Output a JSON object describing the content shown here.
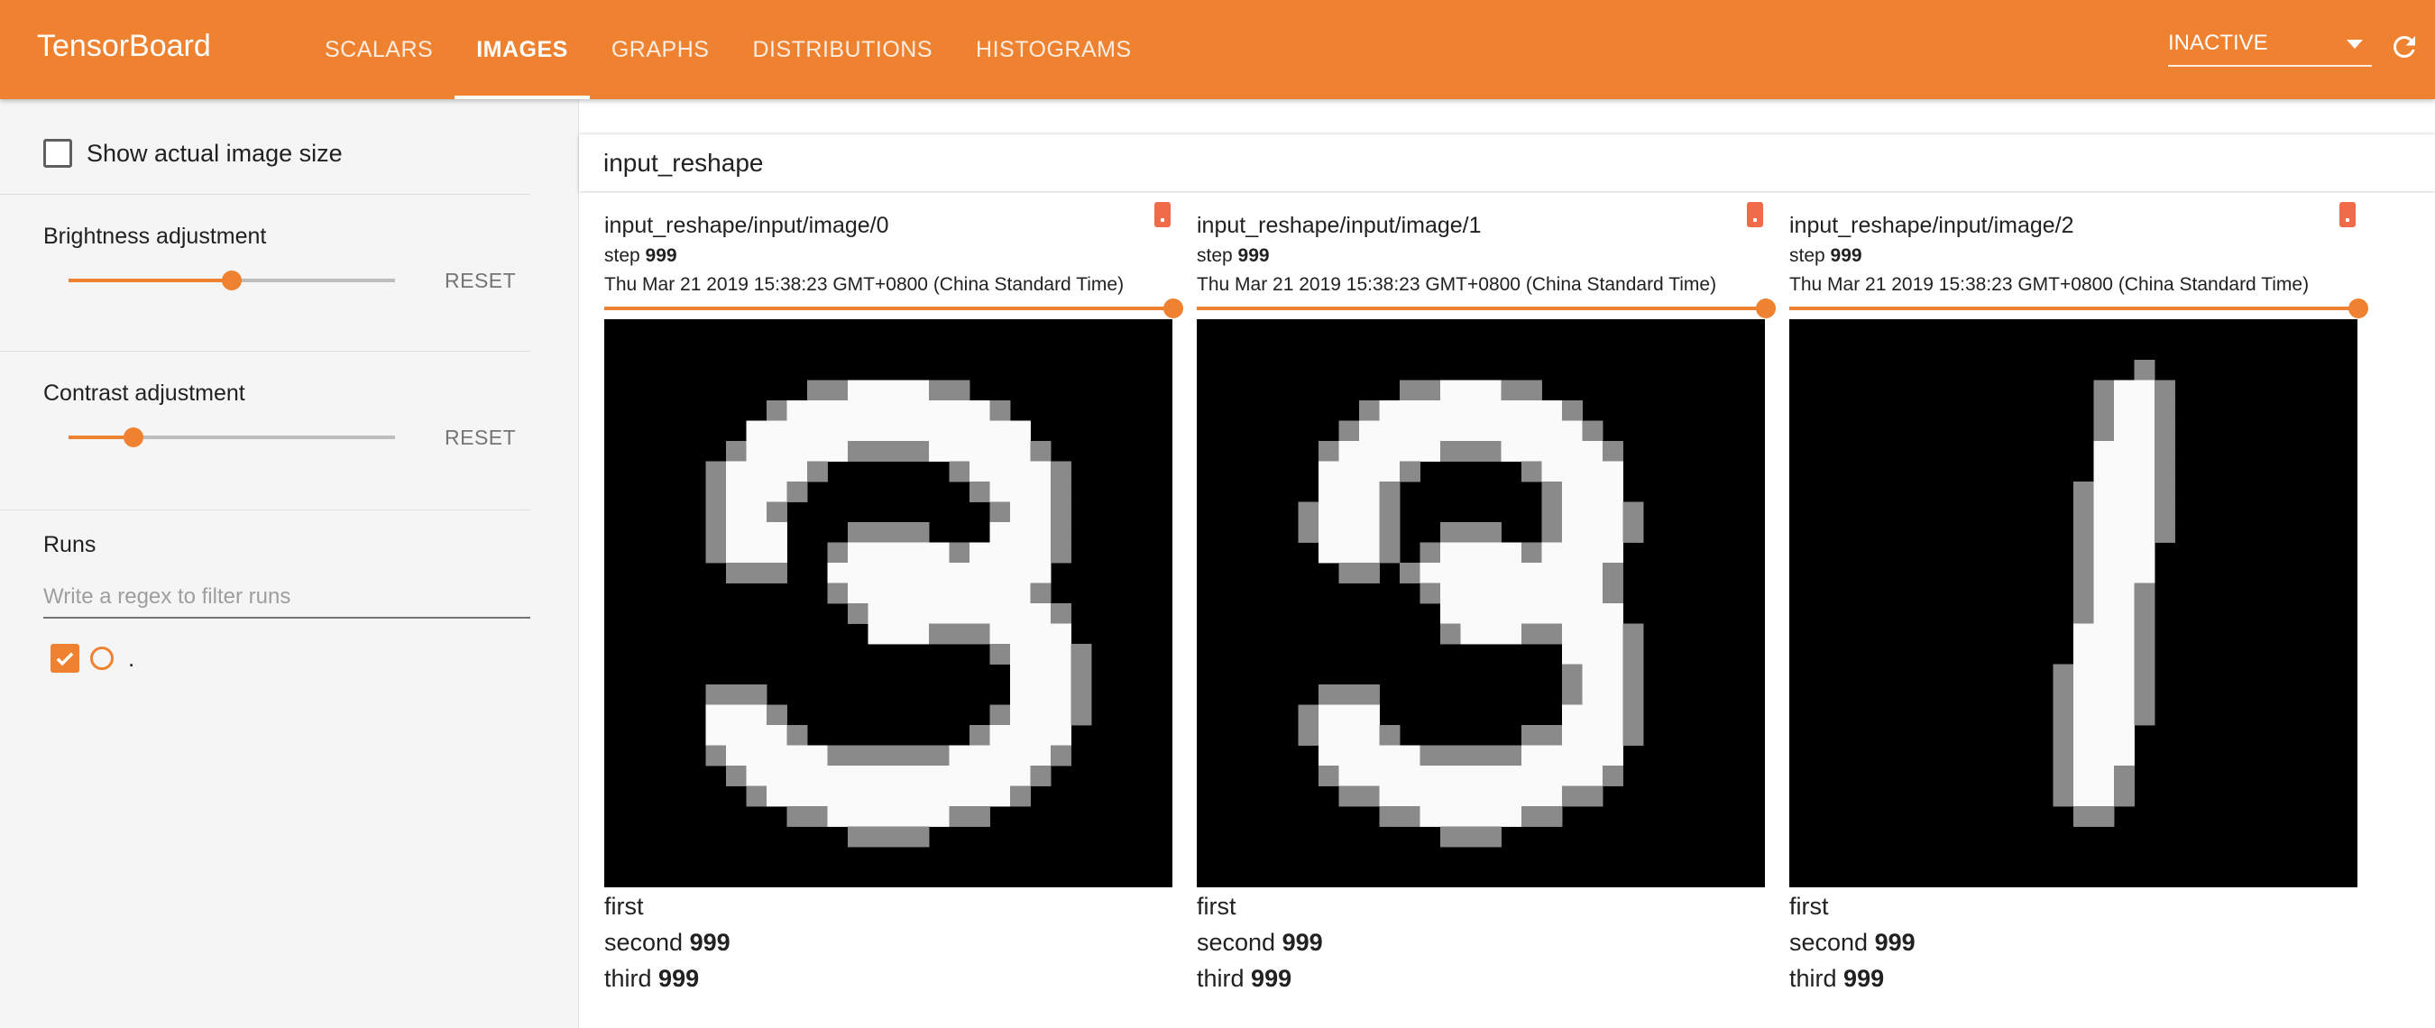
{
  "app": {
    "title": "TensorBoard"
  },
  "tabs": [
    {
      "label": "SCALARS",
      "active": false
    },
    {
      "label": "IMAGES",
      "active": true
    },
    {
      "label": "GRAPHS",
      "active": false
    },
    {
      "label": "DISTRIBUTIONS",
      "active": false
    },
    {
      "label": "HISTOGRAMS",
      "active": false
    }
  ],
  "status_select": {
    "value": "INACTIVE"
  },
  "colors": {
    "accent": "#ef8230",
    "menu_button": "#ef6b4a"
  },
  "sidebar": {
    "show_actual_size": {
      "label": "Show actual image size",
      "checked": false
    },
    "brightness": {
      "title": "Brightness adjustment",
      "reset": "RESET",
      "level": 0.5
    },
    "contrast": {
      "title": "Contrast adjustment",
      "reset": "RESET",
      "level": 0.2
    },
    "runs": {
      "title": "Runs",
      "filter_placeholder": "Write a regex to filter runs",
      "items": [
        {
          "name": ".",
          "checked": true
        }
      ]
    }
  },
  "group": {
    "title": "input_reshape"
  },
  "cards": [
    {
      "title": "input_reshape/input/image/0",
      "step_label": "step",
      "step": "999",
      "time": "Thu Mar 21 2019 15:38:23 GMT+0800 (China Standard Time)",
      "cap_first": "first",
      "cap_second_label": "second",
      "cap_second_value": "999",
      "cap_third_label": "third",
      "cap_third_value": "999",
      "digit": "3"
    },
    {
      "title": "input_reshape/input/image/1",
      "step_label": "step",
      "step": "999",
      "time": "Thu Mar 21 2019 15:38:23 GMT+0800 (China Standard Time)",
      "cap_first": "first",
      "cap_second_label": "second",
      "cap_second_value": "999",
      "cap_third_label": "third",
      "cap_third_value": "999",
      "digit": "3"
    },
    {
      "title": "input_reshape/input/image/2",
      "step_label": "step",
      "step": "999",
      "time": "Thu Mar 21 2019 15:38:23 GMT+0800 (China Standard Time)",
      "cap_first": "first",
      "cap_second_label": "second",
      "cap_second_value": "999",
      "cap_third_label": "third",
      "cap_third_value": "999",
      "digit": "1"
    }
  ],
  "icons": {
    "reload": "refresh-icon",
    "dropdown": "caret-down-icon",
    "run_check": "check-icon"
  }
}
